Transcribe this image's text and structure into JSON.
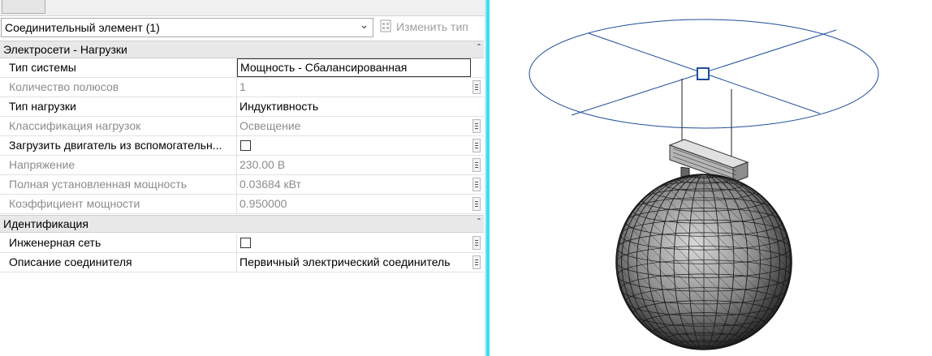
{
  "properties": {
    "type_selector": {
      "value": "Соединительный элемент (1)"
    },
    "edit_type_label": "Изменить тип",
    "sections": [
      {
        "title": "Электросети - Нагрузки",
        "rows": [
          {
            "name": "Тип системы",
            "value": "Мощность - Сбалансированная",
            "editable": true,
            "editing": true
          },
          {
            "name": "Количество полюсов",
            "value": "1",
            "editable": false
          },
          {
            "name": "Тип нагрузки",
            "value": "Индуктивность",
            "editable": true
          },
          {
            "name": "Классификация нагрузок",
            "value": "Освещение",
            "editable": false
          },
          {
            "name": "Загрузить двигатель из вспомогательн...",
            "value": "",
            "checkbox": true,
            "checked": false,
            "editable": true
          },
          {
            "name": "Напряжение",
            "value": "230.00 В",
            "editable": false
          },
          {
            "name": "Полная установленная мощность",
            "value": "0.03684 кВт",
            "editable": false
          },
          {
            "name": "Коэффициент мощности",
            "value": "0.950000",
            "editable": false
          }
        ]
      },
      {
        "title": "Идентификация",
        "rows": [
          {
            "name": "Инженерная сеть",
            "value": "",
            "checkbox": true,
            "checked": false,
            "editable": true
          },
          {
            "name": "Описание соединителя",
            "value": "Первичный электрический соединитель",
            "editable": true
          }
        ]
      }
    ]
  },
  "viewport": {
    "model_description_icon": "pendant-sphere-luminaire",
    "colors": {
      "circle": "#1f4e9a",
      "mesh": "#3a3a3a",
      "splitter": "#3fdcf0"
    }
  }
}
